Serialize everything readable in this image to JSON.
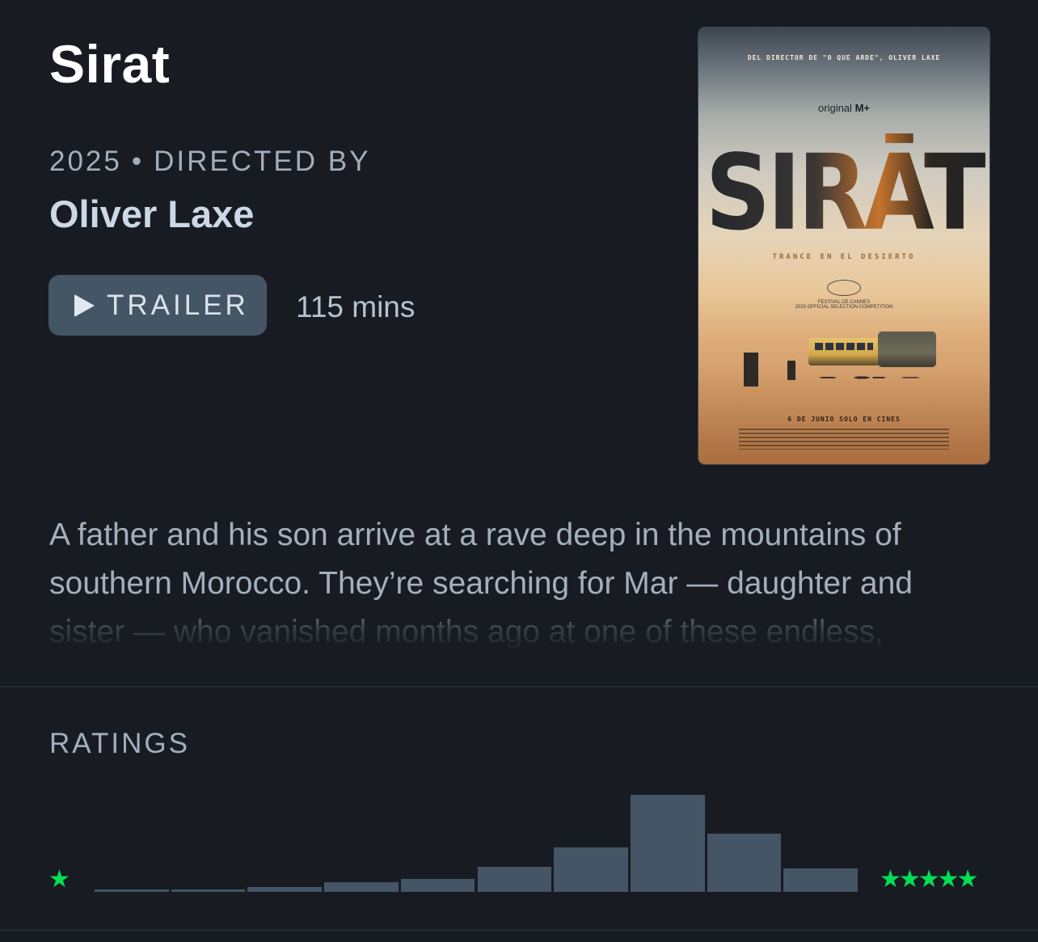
{
  "film": {
    "title": "Sirat",
    "year": "2025",
    "separator": "•",
    "directed_by_label": "DIRECTED BY",
    "director": "Oliver Laxe",
    "trailer_label": "TRAILER",
    "runtime": "115 mins",
    "synopsis": "A father and his son arrive at a rave deep in the mountains of southern Morocco. They’re searching for Mar — daughter and sister — who vanished months ago at one of these endless,"
  },
  "poster": {
    "top_credit": "DEL DIRECTOR DE \"O QUE ARDE\", OLIVER LAXE",
    "studio_prefix": "original",
    "studio_mark": "M+",
    "title": "SIRĀT",
    "tagline": "TRANCE EN EL DESIERTO",
    "festival": "FESTIVAL DE CANNES",
    "festival_sub": "2025 OFFICIAL SELECTION COMPETITION",
    "release": "6 DE JUNIO SOLO EN CINES"
  },
  "ratings": {
    "title": "RATINGS",
    "min_label": "★",
    "max_label": "★★★★★",
    "bar_color": "#445566",
    "star_color": "#00e054",
    "distribution": [
      0.02,
      0.02,
      0.05,
      0.1,
      0.13,
      0.26,
      0.46,
      1.0,
      0.6,
      0.24
    ]
  }
}
